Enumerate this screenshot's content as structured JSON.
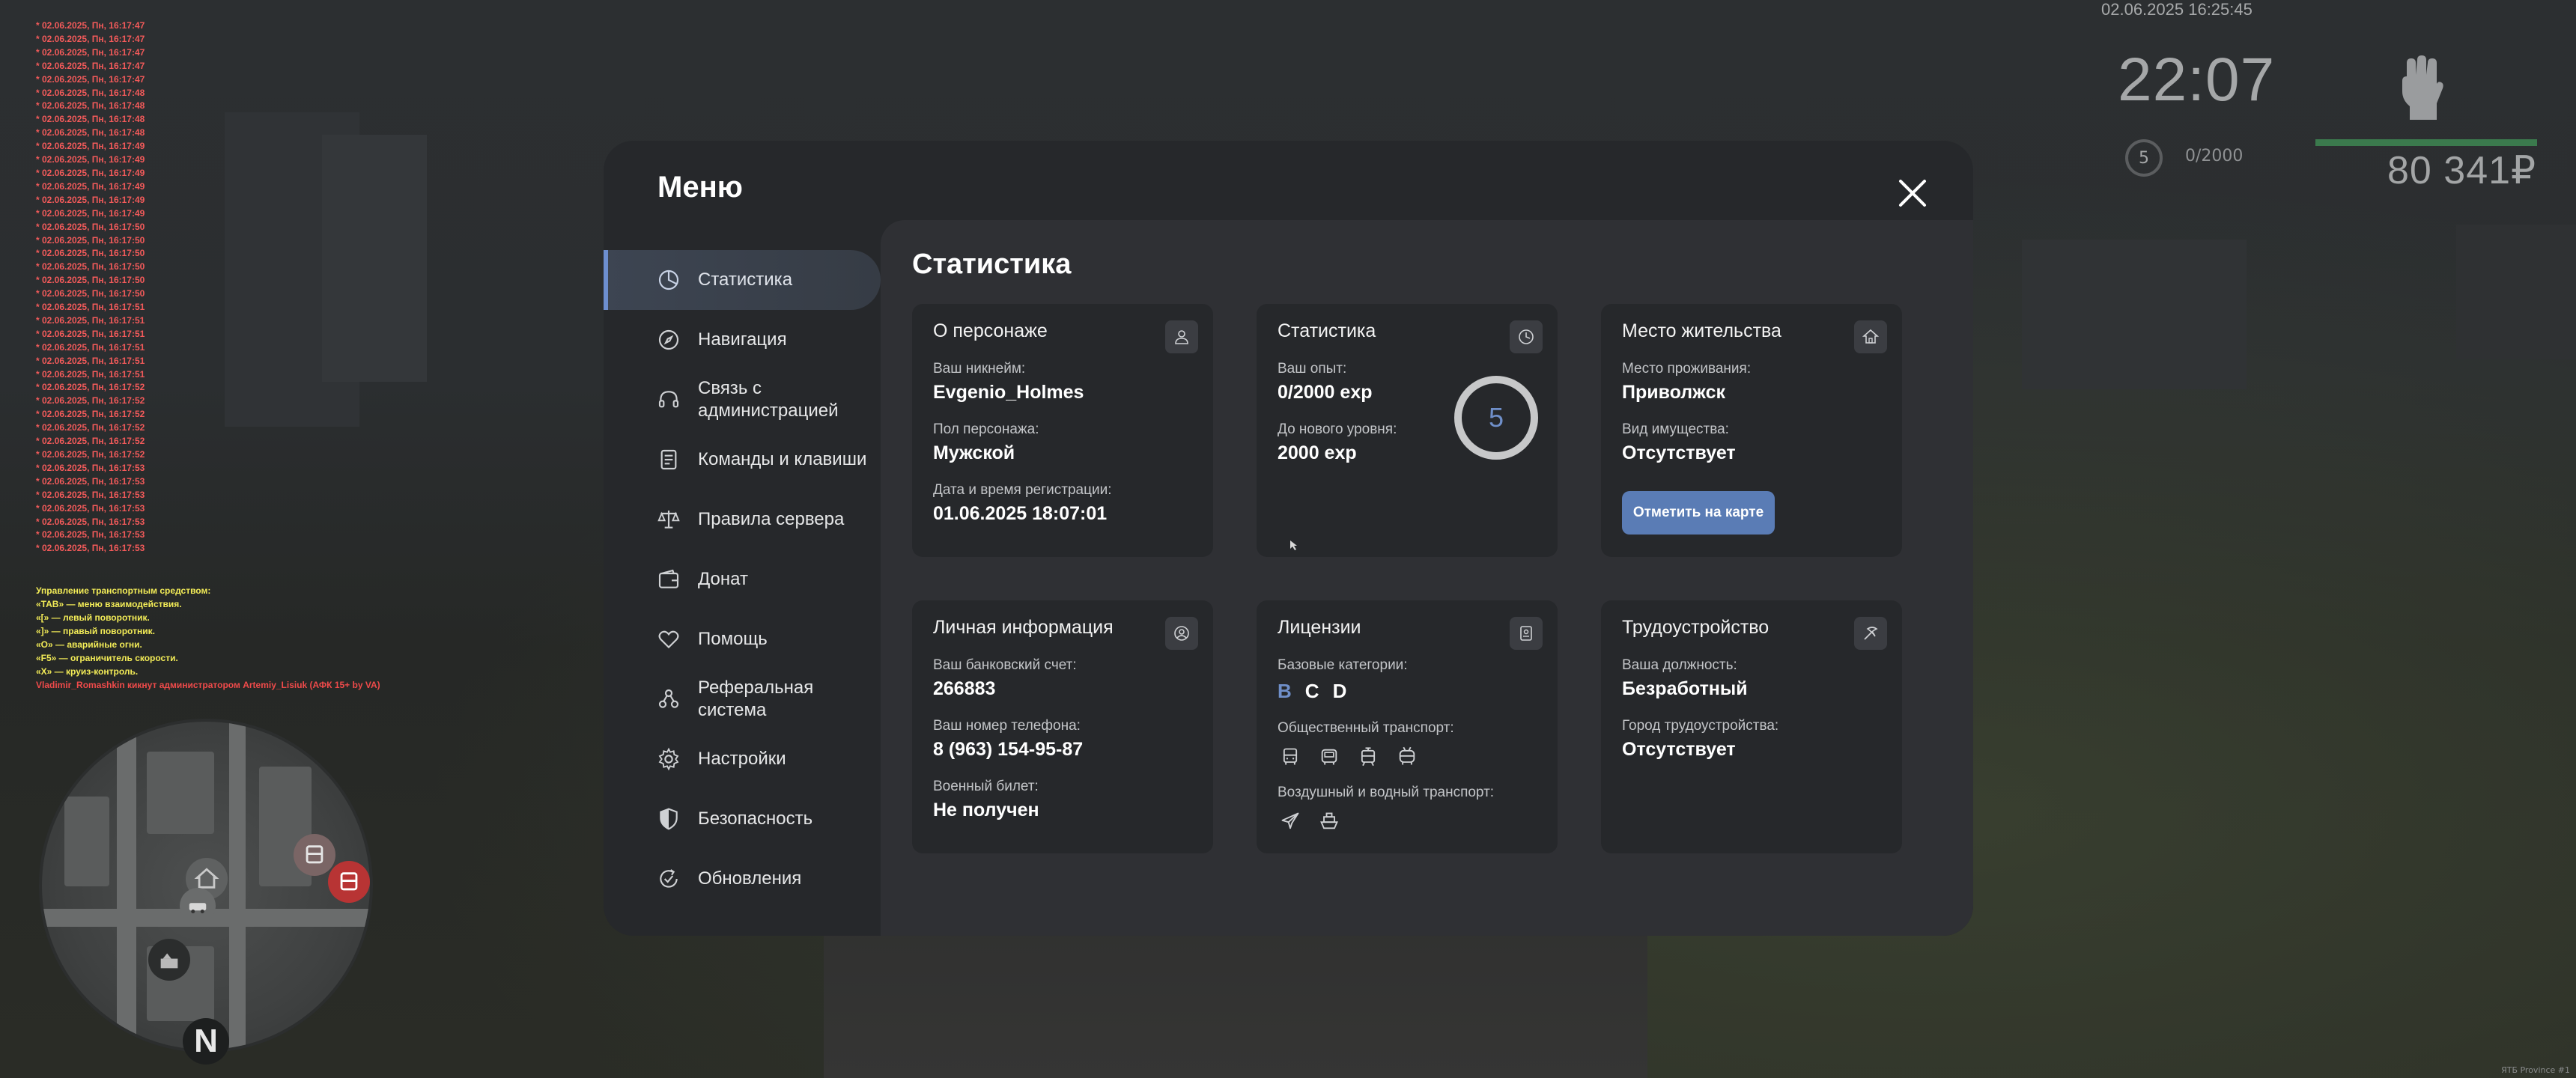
{
  "chat": {
    "timestamps": [
      "* 02.06.2025, Пн, 16:17:47",
      "* 02.06.2025, Пн, 16:17:47",
      "* 02.06.2025, Пн, 16:17:47",
      "* 02.06.2025, Пн, 16:17:47",
      "* 02.06.2025, Пн, 16:17:47",
      "* 02.06.2025, Пн, 16:17:48",
      "* 02.06.2025, Пн, 16:17:48",
      "* 02.06.2025, Пн, 16:17:48",
      "* 02.06.2025, Пн, 16:17:48",
      "* 02.06.2025, Пн, 16:17:49",
      "* 02.06.2025, Пн, 16:17:49",
      "* 02.06.2025, Пн, 16:17:49",
      "* 02.06.2025, Пн, 16:17:49",
      "* 02.06.2025, Пн, 16:17:49",
      "* 02.06.2025, Пн, 16:17:49",
      "* 02.06.2025, Пн, 16:17:50",
      "* 02.06.2025, Пн, 16:17:50",
      "* 02.06.2025, Пн, 16:17:50",
      "* 02.06.2025, Пн, 16:17:50",
      "* 02.06.2025, Пн, 16:17:50",
      "* 02.06.2025, Пн, 16:17:50",
      "* 02.06.2025, Пн, 16:17:51",
      "* 02.06.2025, Пн, 16:17:51",
      "* 02.06.2025, Пн, 16:17:51",
      "* 02.06.2025, Пн, 16:17:51",
      "* 02.06.2025, Пн, 16:17:51",
      "* 02.06.2025, Пн, 16:17:51",
      "* 02.06.2025, Пн, 16:17:52",
      "* 02.06.2025, Пн, 16:17:52",
      "* 02.06.2025, Пн, 16:17:52",
      "* 02.06.2025, Пн, 16:17:52",
      "* 02.06.2025, Пн, 16:17:52",
      "* 02.06.2025, Пн, 16:17:52",
      "* 02.06.2025, Пн, 16:17:53",
      "* 02.06.2025, Пн, 16:17:53",
      "* 02.06.2025, Пн, 16:17:53",
      "* 02.06.2025, Пн, 16:17:53",
      "* 02.06.2025, Пн, 16:17:53",
      "* 02.06.2025, Пн, 16:17:53",
      "* 02.06.2025, Пн, 16:17:53"
    ],
    "help_title": "Управление транспортным средством:",
    "help_lines": [
      "«TAB» — меню взаимодействия.",
      "«[» — левый поворотник.",
      "«]» — правый поворотник.",
      "«O» — аварийные огни.",
      "«F5» — ограничитель скорости.",
      "«X» — круиз-контроль."
    ],
    "admin_line": "Vladimir_Romashkin кикнут администратором Artemiy_Lisiuk (АФК 15+ by VA)"
  },
  "hud": {
    "datetime": "02.06.2025 16:25:45",
    "clock": "22:07",
    "level": "5",
    "exp": "0/2000",
    "money": "80 341₽",
    "health_fraction": 1.0,
    "footer": "ЯТБ Province #1"
  },
  "minimap": {
    "north_label": "N"
  },
  "menu": {
    "title": "Меню",
    "nav": [
      {
        "label": "Статистика",
        "icon": "chart-pie-icon"
      },
      {
        "label": "Навигация",
        "icon": "compass-icon"
      },
      {
        "label": "Связь с администрацией",
        "icon": "headset-icon"
      },
      {
        "label": "Команды и клавиши",
        "icon": "keyboard-icon"
      },
      {
        "label": "Правила сервера",
        "icon": "scales-icon"
      },
      {
        "label": "Донат",
        "icon": "wallet-icon"
      },
      {
        "label": "Помощь",
        "icon": "heart-hand-icon"
      },
      {
        "label": "Реферальная система",
        "icon": "referral-icon"
      },
      {
        "label": "Настройки",
        "icon": "gear-icon"
      },
      {
        "label": "Безопасность",
        "icon": "shield-icon"
      },
      {
        "label": "Обновления",
        "icon": "update-icon"
      }
    ],
    "active_index": 0
  },
  "stats": {
    "title": "Статистика",
    "character": {
      "title": "О персонаже",
      "nickname_label": "Ваш никнейм:",
      "nickname": "Evgenio_Holmes",
      "gender_label": "Пол персонажа:",
      "gender": "Мужской",
      "reg_label": "Дата и время регистрации:",
      "reg": "01.06.2025 18:07:01"
    },
    "statistics": {
      "title": "Статистика",
      "exp_label": "Ваш опыт:",
      "exp": "0/2000 exp",
      "next_label": "До нового уровня:",
      "next": "2000 exp",
      "level": "5"
    },
    "residence": {
      "title": "Место жительства",
      "place_label": "Место проживания:",
      "place": "Приволжск",
      "property_label": "Вид имущества:",
      "property": "Отсутствует",
      "map_button": "Отметить на карте"
    },
    "personal": {
      "title": "Личная информация",
      "bank_label": "Ваш банковский счет:",
      "bank": "266883",
      "phone_label": "Ваш номер телефона:",
      "phone": "8 (963) 154-95-87",
      "military_label": "Военный билет:",
      "military": "Не получен"
    },
    "licenses": {
      "title": "Лицензии",
      "base_label": "Базовые категории:",
      "categories": [
        {
          "name": "B",
          "active": true
        },
        {
          "name": "C",
          "active": false
        },
        {
          "name": "D",
          "active": false
        }
      ],
      "public_label": "Общественный транспорт:",
      "public_icons": [
        "bus-icon",
        "bus-front-icon",
        "tram-icon",
        "trolleybus-icon"
      ],
      "air_label": "Воздушный и водный транспорт:",
      "air_icons": [
        "plane-icon",
        "boat-icon"
      ]
    },
    "employment": {
      "title": "Трудоустройство",
      "position_label": "Ваша должность:",
      "position": "Безработный",
      "city_label": "Город трудоустройства:",
      "city": "Отсутствует"
    }
  },
  "colors": {
    "accent": "#6f8fc9",
    "button": "#5a7cb5",
    "card": "#26282b",
    "panel": "#2f3034",
    "modal": "#26282b",
    "chat_timestamp": "#f35a5a",
    "chat_help": "#f3ec57"
  }
}
